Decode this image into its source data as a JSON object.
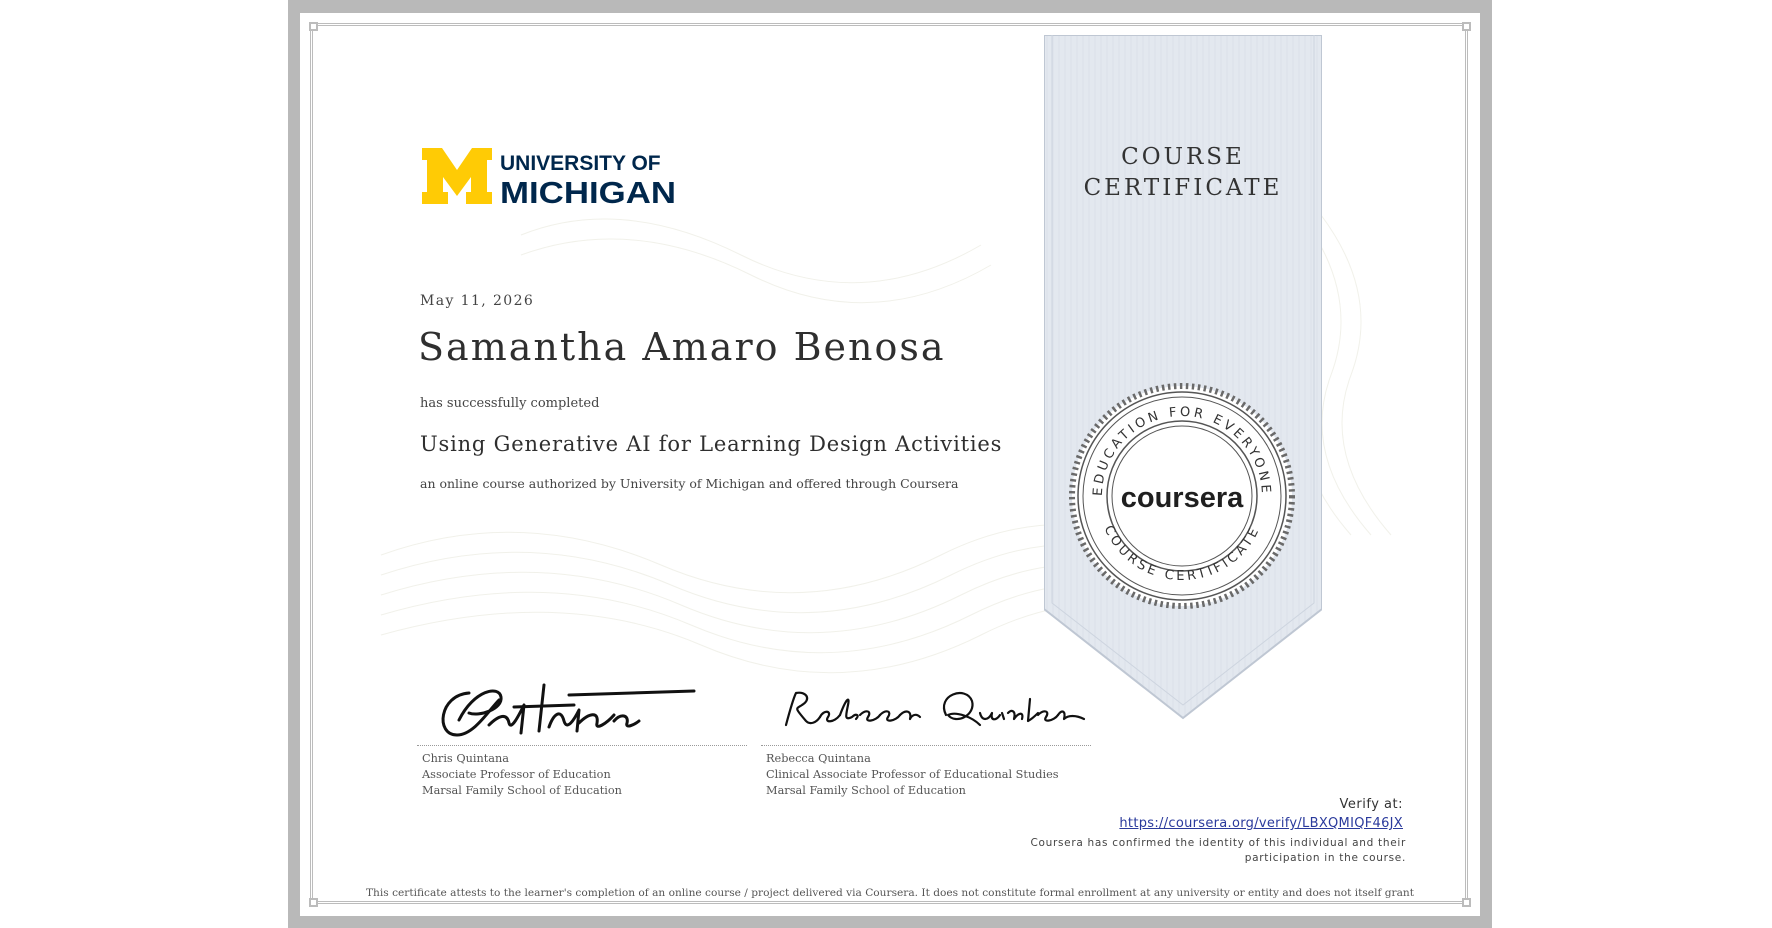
{
  "university": {
    "logo_mark": "M",
    "logo_line1": "UNIVERSITY OF",
    "logo_line2": "MICHIGAN"
  },
  "certificate": {
    "type_line1": "COURSE",
    "type_line2": "CERTIFICATE",
    "date": "May 11, 2026",
    "recipient_name": "Samantha Amaro Benosa",
    "completed_text": "has successfully completed",
    "course_title": "Using Generative AI for Learning Design Activities",
    "offered_text": "an online course authorized by University of Michigan and offered through Coursera"
  },
  "instructors": [
    {
      "name": "Chris Quintana",
      "title": "Associate Professor of Education",
      "school": "Marsal Family School of Education"
    },
    {
      "name": "Rebecca Quintana",
      "title": "Clinical Associate Professor of Educational Studies",
      "school": "Marsal Family School of Education"
    }
  ],
  "seal": {
    "top_text": "EDUCATION FOR EVERYONE",
    "bottom_text": "COURSE CERTIFICATE",
    "wordmark": "coursera"
  },
  "verification": {
    "label": "Verify at:",
    "url": "https://coursera.org/verify/LBXQMIQF46JX",
    "confirmation": "Coursera has confirmed the identity of this individual and their participation in the course."
  },
  "disclaimer": "This certificate attests to the learner's completion of an online course / project delivered via Coursera. It does not constitute formal enrollment at any university or entity and does not itself grant academic credit, grades, or a degree. Institutions or organizations may, at their discretion, recognize this learning toward their own programs or credentials.",
  "colors": {
    "michigan_maize": "#FFCB05",
    "michigan_blue": "#00274C",
    "ribbon": "#e3e8ef",
    "link": "#2a3a9c"
  }
}
